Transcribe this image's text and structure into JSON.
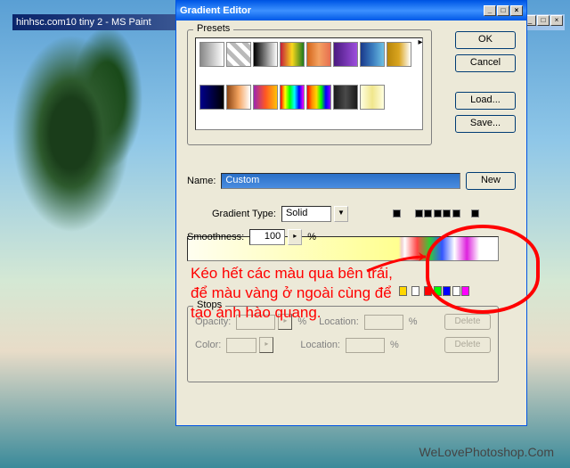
{
  "main_window": {
    "title": "hinhsc.com10 tiny 2 - MS Paint"
  },
  "dialog": {
    "title": "Gradient Editor",
    "presets": {
      "label": "Presets",
      "swatches_css": [
        "linear-gradient(90deg,#888,#fff)",
        "repeating-linear-gradient(45deg,#bababa,#bababa 5px,#fff 5px,#fff 10px)",
        "linear-gradient(90deg,#000,#fff)",
        "linear-gradient(90deg,#c41e3a,#f9d71c,#1e7a1e)",
        "linear-gradient(90deg,#d4651a,#f4a261,#e76f51)",
        "linear-gradient(90deg,#4a1a80,#9d4edd)",
        "linear-gradient(90deg,#1a3a8a,#3a7abd,#6ec1e4)",
        "linear-gradient(90deg,#b8860b,#daa520,#fff)",
        "linear-gradient(90deg,#00008b,#000)",
        "linear-gradient(90deg,#8b4513,#f4a460,#fff)",
        "linear-gradient(90deg,#9c27b0,#ff5722,#ffc107)",
        "linear-gradient(90deg,#ff0000,#ffff00,#00ff00,#00ffff,#0000ff,#ff00ff)",
        "linear-gradient(90deg,#ff0000,#ff8c00,#ffd700,#00ff00,#0000ff,#8b00ff)",
        "linear-gradient(90deg,#1a1a1a,#4a4a4a,#1a1a1a)",
        "linear-gradient(90deg,#ffffe0,#f0e68c,#ffffe0)"
      ]
    },
    "buttons": {
      "ok": "OK",
      "cancel": "Cancel",
      "load": "Load...",
      "save": "Save...",
      "new": "New",
      "delete": "Delete"
    },
    "name": {
      "label": "Name:",
      "value": "Custom"
    },
    "gradient_type": {
      "label": "Gradient Type:",
      "value": "Solid"
    },
    "smoothness": {
      "label": "Smoothness:",
      "value": "100",
      "unit": "%"
    },
    "stops": {
      "label": "Stops",
      "opacity_label": "Opacity:",
      "opacity_unit": "%",
      "location_label": "Location:",
      "location_unit": "%",
      "color_label": "Color:",
      "opacity_positions": [
        66,
        73,
        76,
        79,
        82,
        85,
        91
      ],
      "color_stops": [
        {
          "pos": 68,
          "color": "#ffd700"
        },
        {
          "pos": 72,
          "color": "#ffffff"
        },
        {
          "pos": 76,
          "color": "#ff0000"
        },
        {
          "pos": 79,
          "color": "#00ff00"
        },
        {
          "pos": 82,
          "color": "#0000ff"
        },
        {
          "pos": 85,
          "color": "#ffffff"
        },
        {
          "pos": 88,
          "color": "#ff00ff"
        }
      ]
    }
  },
  "annotation": "Kéo hết các màu qua bên trái, để màu vàng ở ngoài cùng để tạo ánh hào quang.",
  "watermark": "WeLovePhotoshop.Com"
}
